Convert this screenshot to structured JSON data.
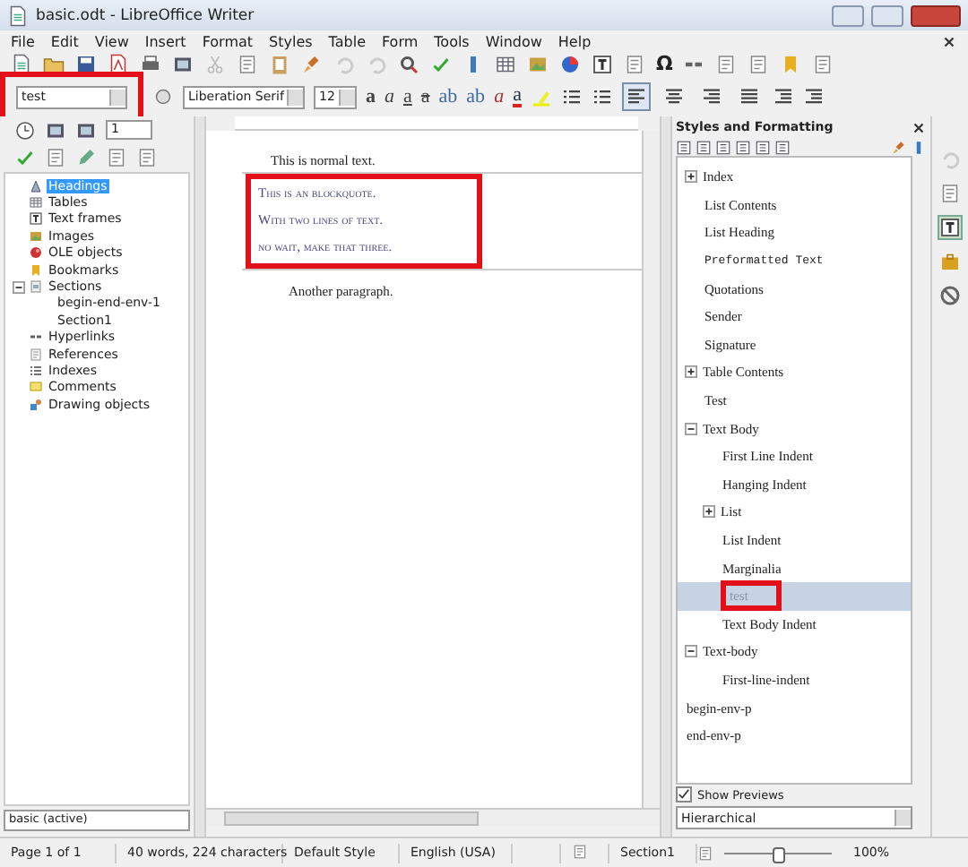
{
  "window": {
    "title": "basic.odt - LibreOffice Writer"
  },
  "menu": [
    "File",
    "Edit",
    "View",
    "Insert",
    "Format",
    "Styles",
    "Table",
    "Form",
    "Tools",
    "Window",
    "Help"
  ],
  "toolbar": {
    "omega": "Ω"
  },
  "formatting": {
    "style": "test",
    "font": "Liberation Serif",
    "size": "12",
    "text_buttons": [
      {
        "label": "a",
        "kind": "bold"
      },
      {
        "label": "a",
        "kind": "italic"
      },
      {
        "label": "a",
        "kind": "underline"
      },
      {
        "label": "a",
        "kind": "strike"
      },
      {
        "label": "ab",
        "kind": "super"
      },
      {
        "label": "ab",
        "kind": "sub"
      },
      {
        "label": "a",
        "kind": "clear"
      },
      {
        "label": "a",
        "kind": "color"
      }
    ],
    "alignment": [
      {
        "selected": true
      },
      {
        "selected": false
      },
      {
        "selected": false
      },
      {
        "selected": false
      }
    ]
  },
  "navigator": {
    "page": "1",
    "items": [
      {
        "label": "Headings",
        "kind": "heading",
        "selected": true
      },
      {
        "label": "Tables",
        "kind": "table",
        "selected": false
      },
      {
        "label": "Text frames",
        "kind": "frame",
        "selected": false
      },
      {
        "label": "Images",
        "kind": "image",
        "selected": false
      },
      {
        "label": "OLE objects",
        "kind": "ole",
        "selected": false
      },
      {
        "label": "Bookmarks",
        "kind": "bookmark",
        "selected": false
      },
      {
        "label": "Sections",
        "kind": "section",
        "selected": false,
        "expanded": true,
        "children": [
          {
            "label": "begin-end-env-1"
          },
          {
            "label": "Section1"
          }
        ]
      },
      {
        "label": "Hyperlinks",
        "kind": "hyperlink",
        "selected": false
      },
      {
        "label": "References",
        "kind": "reference",
        "selected": false
      },
      {
        "label": "Indexes",
        "kind": "index",
        "selected": false
      },
      {
        "label": "Comments",
        "kind": "comment",
        "selected": false
      },
      {
        "label": "Drawing objects",
        "kind": "drawing",
        "selected": false
      }
    ],
    "document": "basic (active)"
  },
  "document": {
    "normal": "This is normal text.",
    "blockquote": [
      "This is an blockquote.",
      "With two lines of text.",
      "no wait, make that three."
    ],
    "after": "Another paragraph."
  },
  "styles_panel": {
    "title": "Styles and Formatting",
    "items": [
      {
        "label": "Index",
        "kind": "serif",
        "selected": false,
        "expanded": false
      },
      {
        "label": "List Contents",
        "kind": "serif",
        "selected": false
      },
      {
        "label": "List Heading",
        "kind": "serif",
        "selected": false
      },
      {
        "label": "Preformatted Text",
        "kind": "mono",
        "selected": false
      },
      {
        "label": "Quotations",
        "kind": "serif",
        "selected": false
      },
      {
        "label": "Sender",
        "kind": "serif",
        "selected": false
      },
      {
        "label": "Signature",
        "kind": "serif",
        "selected": false
      },
      {
        "label": "Table Contents",
        "kind": "serif",
        "selected": false,
        "expanded": false
      },
      {
        "label": "Test",
        "kind": "serif",
        "selected": false
      },
      {
        "label": "Text Body",
        "kind": "serif",
        "selected": false,
        "expanded": true,
        "children": [
          {
            "label": "First Line Indent",
            "kind": "serif",
            "selected": false
          },
          {
            "label": "Hanging Indent",
            "kind": "serif",
            "selected": false
          },
          {
            "label": "List",
            "kind": "serif",
            "selected": false,
            "expanded": false
          },
          {
            "label": "List Indent",
            "kind": "serif",
            "selected": false
          },
          {
            "label": "Marginalia",
            "kind": "serif",
            "selected": false
          },
          {
            "label": "test",
            "kind": "faint",
            "selected": true
          },
          {
            "label": "Text Body Indent",
            "kind": "serif",
            "selected": false
          }
        ]
      },
      {
        "label": "Text-body",
        "kind": "serif",
        "selected": false,
        "expanded": true,
        "children": [
          {
            "label": "First-line-indent",
            "kind": "serif",
            "selected": false
          }
        ]
      },
      {
        "label": "begin-env-p",
        "kind": "serif",
        "selected": false,
        "outer": true
      },
      {
        "label": "end-env-p",
        "kind": "serif",
        "selected": false,
        "outer": true
      }
    ],
    "show_previews": {
      "label": "Show Previews",
      "checked": true
    },
    "filter": "Hierarchical"
  },
  "status_bar": {
    "page": "Page 1 of 1",
    "words": "40 words, 224 characters",
    "style": "Default Style",
    "language": "English (USA)",
    "section": "Section1",
    "zoom": "100%",
    "level": 0.5
  }
}
